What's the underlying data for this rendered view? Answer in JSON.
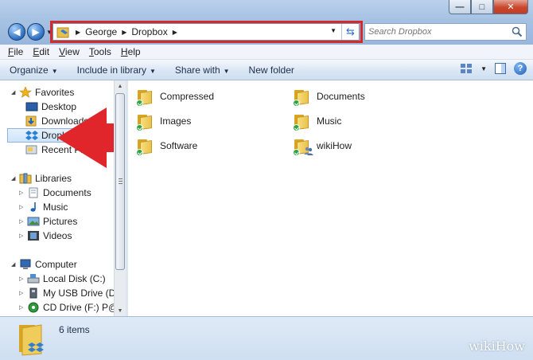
{
  "window": {
    "minimize_glyph": "—",
    "maximize_glyph": "□",
    "close_glyph": "✕"
  },
  "address_bar": {
    "breadcrumbs": [
      "George",
      "Dropbox"
    ],
    "highlight_color": "#d62a2a"
  },
  "search": {
    "placeholder": "Search Dropbox"
  },
  "menu": {
    "items": [
      "File",
      "Edit",
      "View",
      "Tools",
      "Help"
    ]
  },
  "commands": {
    "organize": "Organize",
    "include_in_library": "Include in library",
    "share_with": "Share with",
    "new_folder": "New folder"
  },
  "nav": {
    "favorites": "Favorites",
    "desktop": "Desktop",
    "downloads": "Downloads",
    "dropbox": "Dropbox",
    "recent_places": "Recent Places",
    "libraries": "Libraries",
    "documents": "Documents",
    "music": "Music",
    "pictures": "Pictures",
    "videos": "Videos",
    "computer": "Computer",
    "local_disk": "Local Disk (C:)",
    "usb_drive": "My USB Drive (D:)",
    "cd_drive": "CD Drive (F:) P@v@r"
  },
  "files": [
    {
      "name": "Compressed",
      "icon": "folder-icon",
      "synced": true
    },
    {
      "name": "Documents",
      "icon": "folder-icon",
      "synced": true
    },
    {
      "name": "Images",
      "icon": "folder-icon",
      "synced": true
    },
    {
      "name": "Music",
      "icon": "folder-icon",
      "synced": true
    },
    {
      "name": "Software",
      "icon": "folder-icon",
      "synced": true
    },
    {
      "name": "wikiHow",
      "icon": "shared-folder-icon",
      "synced": true
    }
  ],
  "details": {
    "item_count": "6 items"
  },
  "watermark": "wikiHow",
  "colors": {
    "accent": "#2c6fc1",
    "arrow": "#e0262b",
    "sync_badge": "#2da543"
  }
}
